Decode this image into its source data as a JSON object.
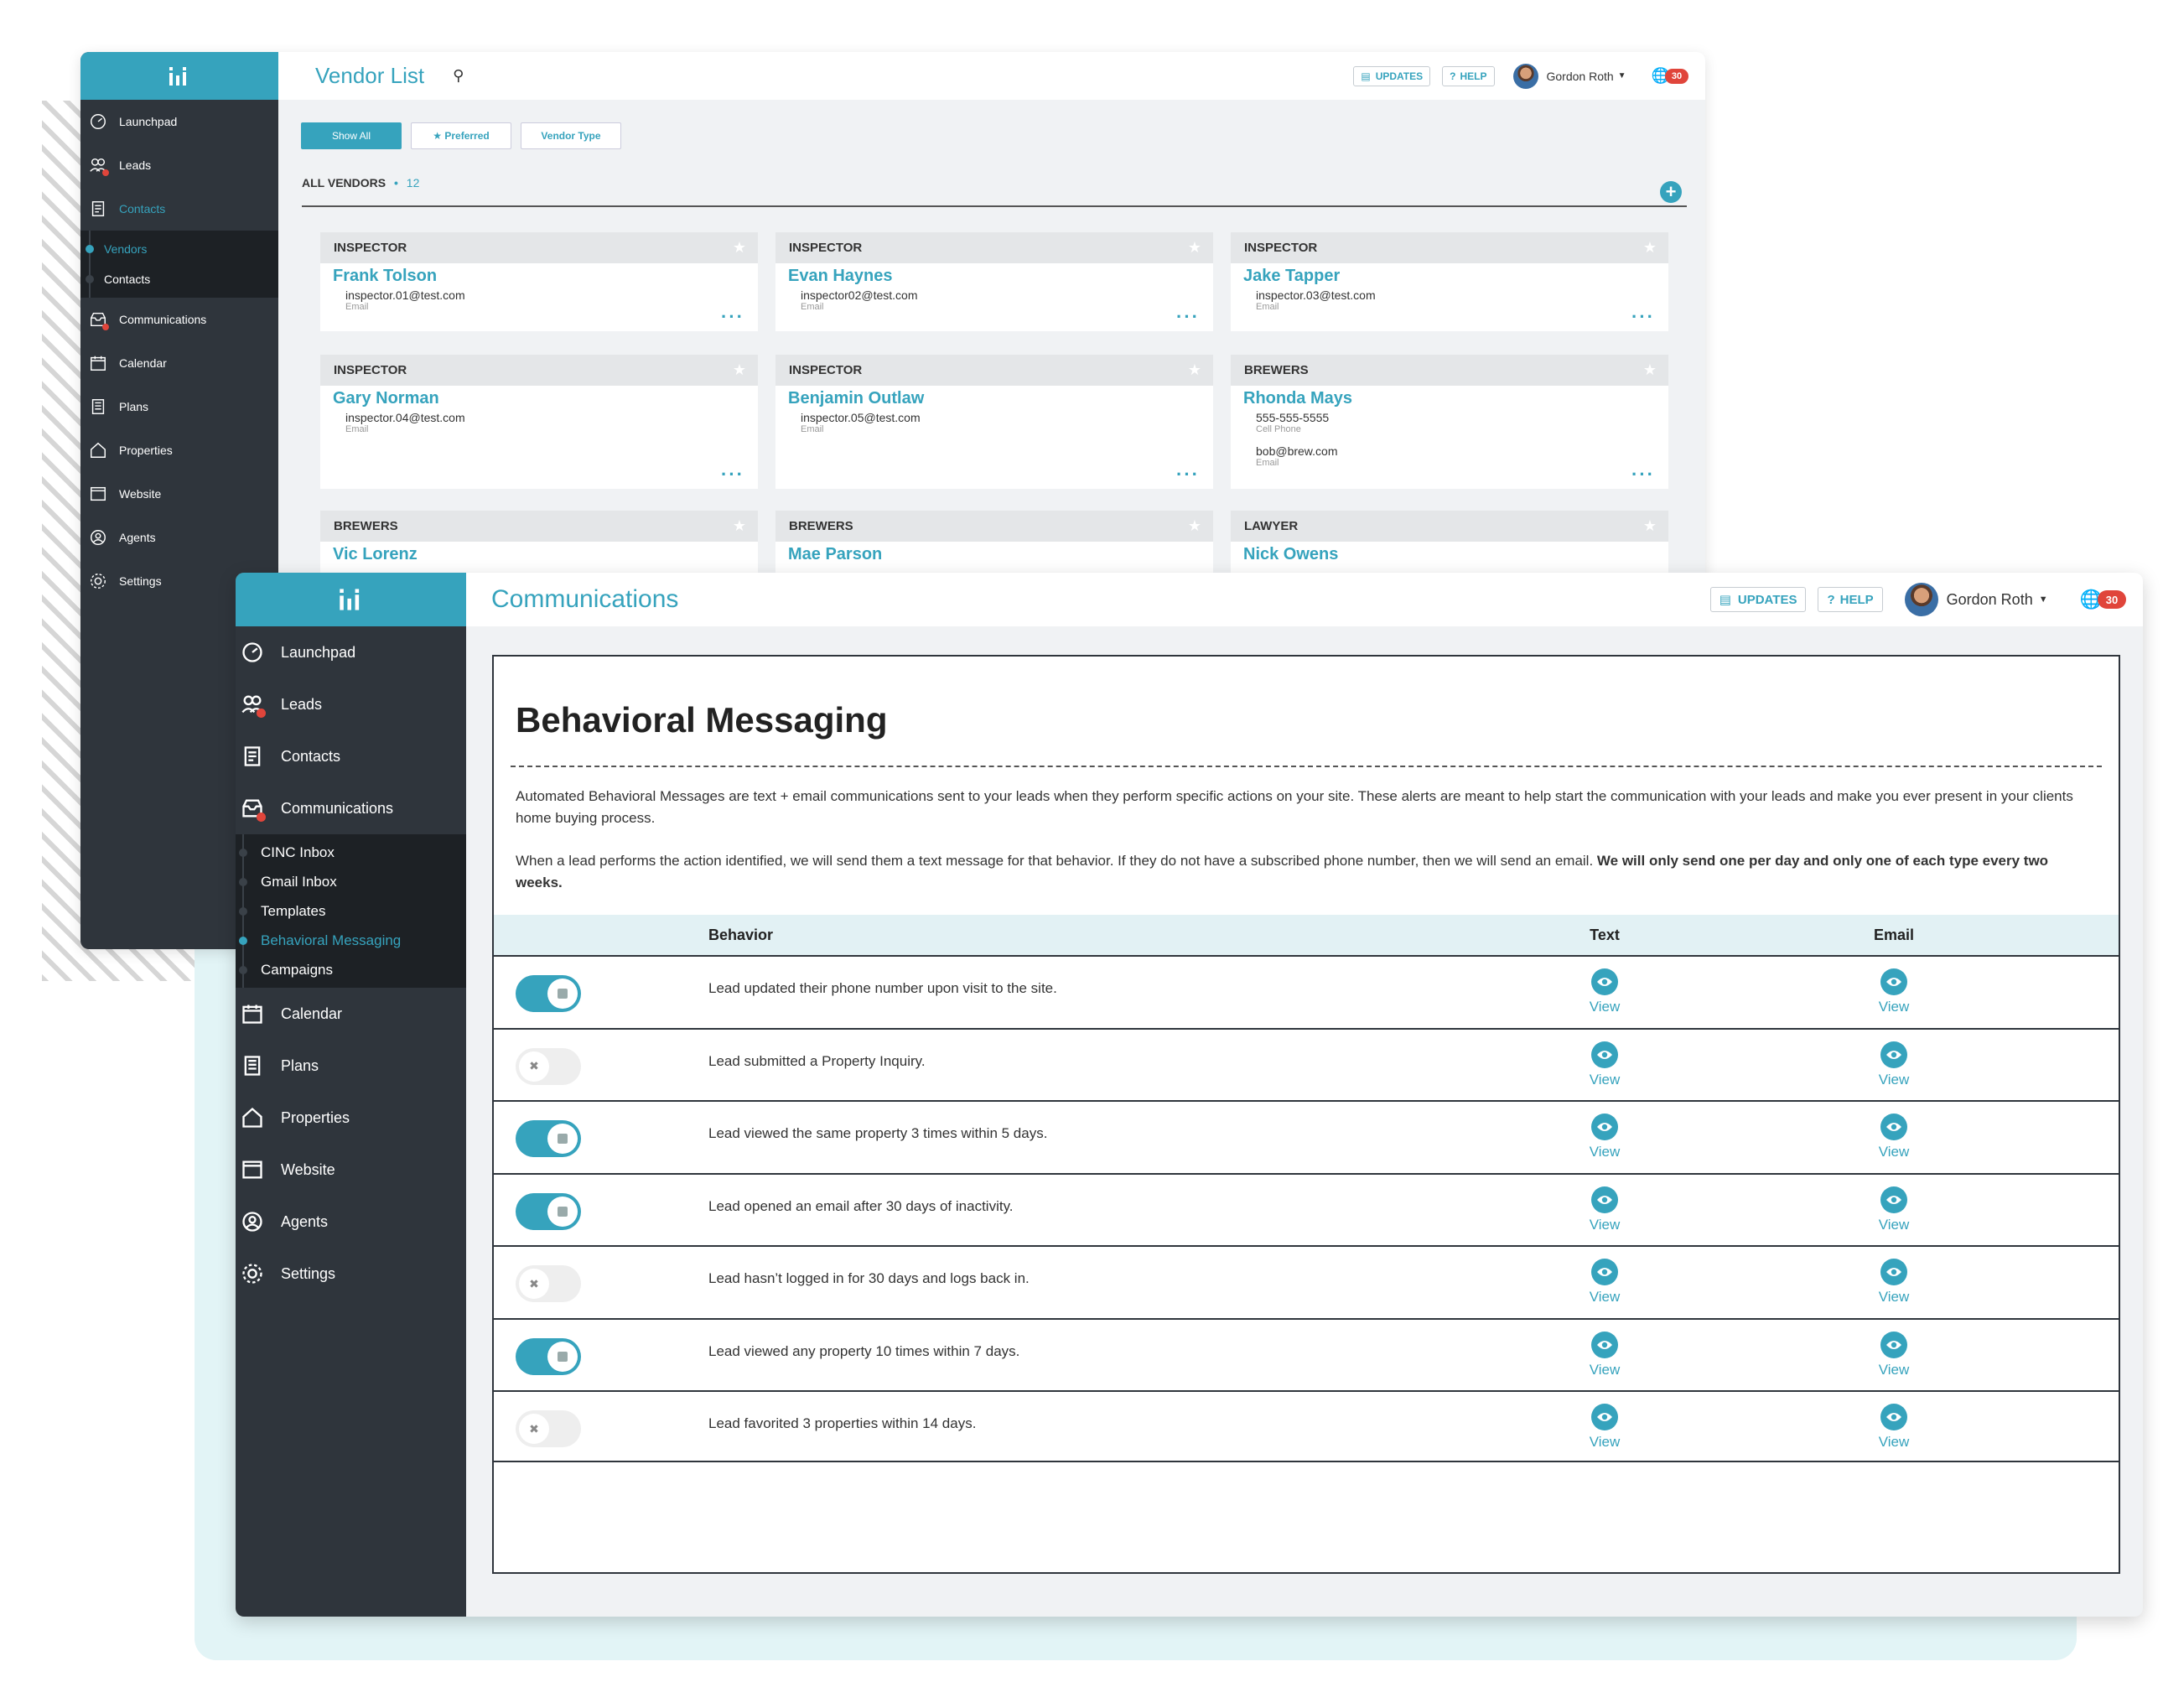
{
  "vendor_window": {
    "title": "Vendor List",
    "topbar": {
      "updates": "UPDATES",
      "help": "HELP",
      "user": "Gordon Roth",
      "badge": "30"
    },
    "sidebar": {
      "items": [
        {
          "label": "Launchpad",
          "icon": "launchpad-icon"
        },
        {
          "label": "Leads",
          "icon": "leads-icon"
        },
        {
          "label": "Contacts",
          "icon": "contacts-icon"
        },
        {
          "label": "Communications",
          "icon": "communications-icon"
        },
        {
          "label": "Calendar",
          "icon": "calendar-icon"
        },
        {
          "label": "Plans",
          "icon": "plans-icon"
        },
        {
          "label": "Properties",
          "icon": "properties-icon"
        },
        {
          "label": "Website",
          "icon": "website-icon"
        },
        {
          "label": "Agents",
          "icon": "agents-icon"
        },
        {
          "label": "Settings",
          "icon": "settings-icon"
        }
      ],
      "sub_items": [
        {
          "label": "Vendors"
        },
        {
          "label": "Contacts"
        }
      ]
    },
    "filters": {
      "show_all": "Show All",
      "preferred": "Preferred",
      "vendor_type": "Vendor Type"
    },
    "all_vendors_label": "ALL VENDORS",
    "count": "12",
    "cards": [
      {
        "type": "INSPECTOR",
        "name": "Frank Tolson",
        "info": [
          {
            "value": "inspector.01@test.com",
            "label": "Email"
          }
        ]
      },
      {
        "type": "INSPECTOR",
        "name": "Evan Haynes",
        "info": [
          {
            "value": "inspector02@test.com",
            "label": "Email"
          }
        ]
      },
      {
        "type": "INSPECTOR",
        "name": "Jake Tapper",
        "info": [
          {
            "value": "inspector.03@test.com",
            "label": "Email"
          }
        ]
      },
      {
        "type": "INSPECTOR",
        "name": "Gary Norman",
        "info": [
          {
            "value": "inspector.04@test.com",
            "label": "Email"
          }
        ]
      },
      {
        "type": "INSPECTOR",
        "name": "Benjamin Outlaw",
        "info": [
          {
            "value": "inspector.05@test.com",
            "label": "Email"
          }
        ]
      },
      {
        "type": "BREWERS",
        "name": "Rhonda Mays",
        "info": [
          {
            "value": "555-555-5555",
            "label": "Cell Phone"
          },
          {
            "value": "bob@brew.com",
            "label": "Email"
          }
        ]
      },
      {
        "type": "BREWERS",
        "name": "Vic Lorenz",
        "info": []
      },
      {
        "type": "BREWERS",
        "name": "Mae Parson",
        "info": []
      },
      {
        "type": "LAWYER",
        "name": "Nick Owens",
        "info": []
      }
    ]
  },
  "comm_window": {
    "title": "Communications",
    "topbar": {
      "updates": "UPDATES",
      "help": "HELP",
      "user": "Gordon Roth",
      "badge": "30"
    },
    "sidebar": {
      "items_top": [
        {
          "label": "Launchpad",
          "icon": "launchpad-icon"
        },
        {
          "label": "Leads",
          "icon": "leads-icon"
        },
        {
          "label": "Contacts",
          "icon": "contacts-icon"
        },
        {
          "label": "Communications",
          "icon": "communications-icon"
        }
      ],
      "sub_items": [
        {
          "label": "CINC Inbox"
        },
        {
          "label": "Gmail Inbox"
        },
        {
          "label": "Templates"
        },
        {
          "label": "Behavioral Messaging"
        },
        {
          "label": "Campaigns"
        }
      ],
      "items_bottom": [
        {
          "label": "Calendar",
          "icon": "calendar-icon"
        },
        {
          "label": "Plans",
          "icon": "plans-icon"
        },
        {
          "label": "Properties",
          "icon": "properties-icon"
        },
        {
          "label": "Website",
          "icon": "website-icon"
        },
        {
          "label": "Agents",
          "icon": "agents-icon"
        },
        {
          "label": "Settings",
          "icon": "settings-icon"
        }
      ]
    },
    "heading": "Behavioral Messaging",
    "intro": "Automated Behavioral Messages are text + email communications sent to your leads when they perform specific actions on your site. These alerts are meant to help start the communication with your leads and make you ever present in your clients home buying process.",
    "rule_normal": "When a lead performs the action identified, we will send them a text message for that behavior. If they do not have a subscribed phone number, then we will send an email.",
    "rule_bold": "We will only send one per day and only one of each type every two weeks.",
    "table": {
      "headers": {
        "behavior": "Behavior",
        "text": "Text",
        "email": "Email"
      },
      "view_label": "View",
      "rows": [
        {
          "behavior": "Lead updated their phone number upon visit to the site.",
          "enabled": true
        },
        {
          "behavior": "Lead submitted a Property Inquiry.",
          "enabled": false
        },
        {
          "behavior": "Lead viewed the same property 3 times within 5 days.",
          "enabled": true
        },
        {
          "behavior": "Lead opened an email after 30 days of inactivity.",
          "enabled": true
        },
        {
          "behavior": "Lead hasn’t logged in for 30 days and logs back in.",
          "enabled": false
        },
        {
          "behavior": "Lead viewed any property 10 times within 7 days.",
          "enabled": true
        },
        {
          "behavior": "Lead favorited 3 properties within 14 days.",
          "enabled": false
        }
      ]
    }
  },
  "colors": {
    "accent": "#36a3bd",
    "sidebar": "#2f353c",
    "subnav": "#1d2125",
    "badge": "#e0453b"
  }
}
